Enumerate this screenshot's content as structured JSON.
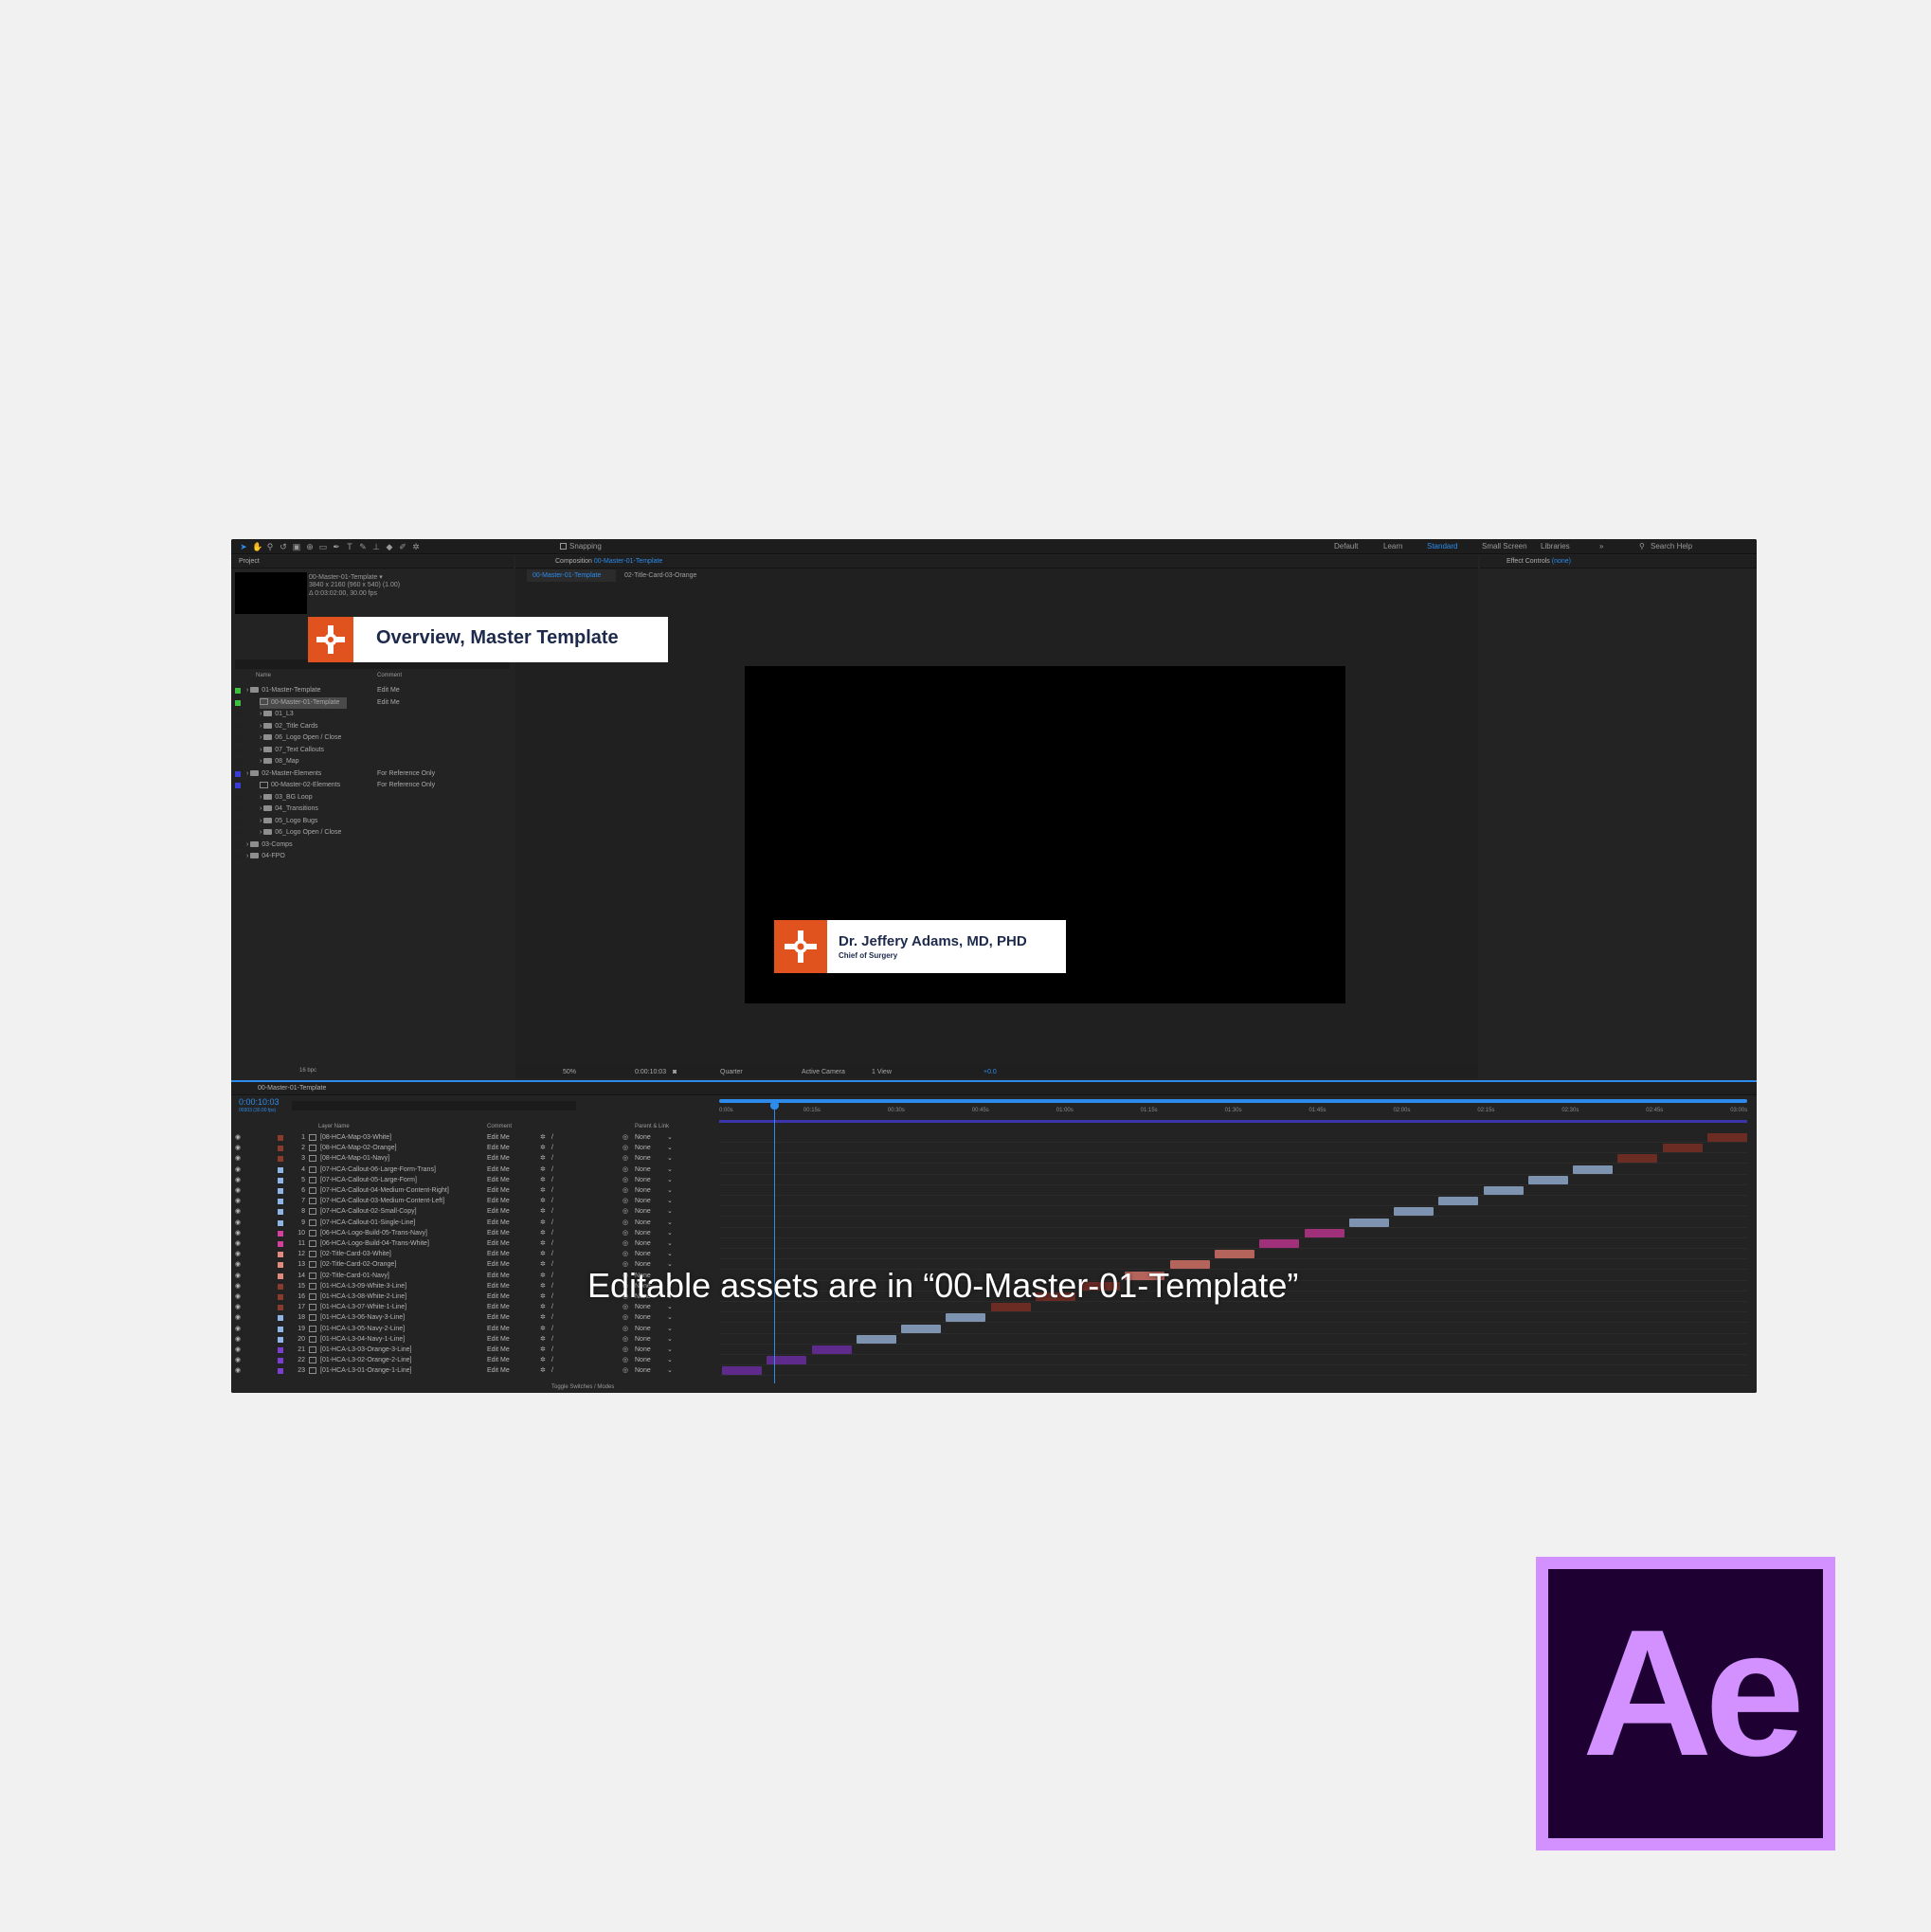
{
  "overlay": {
    "title_badge": "Overview, Master Template",
    "caption": "Editable assets are in “00-Master-01-Template”",
    "ae_logo_text": "Ae"
  },
  "colors": {
    "page_bg": "#f1f1f1",
    "ae_bg": "#232323",
    "brand_orange": "#e0531f",
    "accent_blue": "#2d8ceb",
    "ae_logo_bg": "#1f0033",
    "ae_logo_fg": "#d291ff"
  },
  "toolbar": {
    "snapping": "Snapping",
    "workspaces": [
      "Default",
      "Learn",
      "Standard",
      "Small Screen",
      "Libraries"
    ],
    "active_workspace": "Standard",
    "search_placeholder": "Search Help"
  },
  "project": {
    "panel_title": "Project",
    "selected_name": "00-Master-01-Template ▾",
    "selected_info1": "3840 x 2160  (960 x 540) (1.00)",
    "selected_info2": "Δ 0:03:02:00, 30.00 fps",
    "col_name": "Name",
    "col_comment": "Comment",
    "items": [
      {
        "name": "01-Master-Template",
        "comment": "Edit Me",
        "type": "folder",
        "indent": 0,
        "color": "#3fbf3f"
      },
      {
        "name": "00-Master-01-Template",
        "comment": "Edit Me",
        "type": "comp",
        "indent": 1,
        "color": "#3fbf3f"
      },
      {
        "name": "01_L3",
        "comment": "",
        "type": "folder",
        "indent": 1,
        "color": "#222"
      },
      {
        "name": "02_Title Cards",
        "comment": "",
        "type": "folder",
        "indent": 1,
        "color": "#222"
      },
      {
        "name": "06_Logo Open / Close",
        "comment": "",
        "type": "folder",
        "indent": 1,
        "color": "#222"
      },
      {
        "name": "07_Text Callouts",
        "comment": "",
        "type": "folder",
        "indent": 1,
        "color": "#222"
      },
      {
        "name": "08_Map",
        "comment": "",
        "type": "folder",
        "indent": 1,
        "color": "#222"
      },
      {
        "name": "02-Master-Elements",
        "comment": "For Reference Only",
        "type": "folder",
        "indent": 0,
        "color": "#3b3bd8"
      },
      {
        "name": "00-Master-02-Elements",
        "comment": "For Reference Only",
        "type": "comp",
        "indent": 1,
        "color": "#3b3bd8"
      },
      {
        "name": "03_BG Loop",
        "comment": "",
        "type": "folder",
        "indent": 1,
        "color": "#222"
      },
      {
        "name": "04_Transitions",
        "comment": "",
        "type": "folder",
        "indent": 1,
        "color": "#222"
      },
      {
        "name": "05_Logo Bugs",
        "comment": "",
        "type": "folder",
        "indent": 1,
        "color": "#222"
      },
      {
        "name": "06_Logo Open / Close",
        "comment": "",
        "type": "folder",
        "indent": 1,
        "color": "#222"
      },
      {
        "name": "03-Comps",
        "comment": "",
        "type": "folder",
        "indent": 0,
        "color": "#222"
      },
      {
        "name": "04-FPO",
        "comment": "",
        "type": "folder",
        "indent": 0,
        "color": "#222"
      }
    ],
    "bpc": "16 bpc"
  },
  "composition": {
    "panel_label": "Composition",
    "panel_comp": "00-Master-01-Template",
    "tab_active": "00-Master-01-Template",
    "tab_other": "02-Title-Card-03-Orange",
    "lower_third_name": "Dr. Jeffery Adams, MD, PHD",
    "lower_third_title": "Chief of Surgery",
    "zoom": "50%",
    "timecode": "0:00:10:03",
    "resolution": "Quarter",
    "camera": "Active Camera",
    "view": "1 View",
    "exposure": "+0.0"
  },
  "effects": {
    "panel_label": "Effect Controls",
    "panel_value": "(none)"
  },
  "timeline": {
    "tab": "00-Master-01-Template",
    "timecode": "0:00:10:03",
    "frame_info": "00303 (30.00 fps)",
    "col_layer_name": "Layer Name",
    "col_comment": "Comment",
    "col_parent": "Parent & Link",
    "toggle_label": "Toggle Switches / Modes",
    "ruler": [
      "0:00s",
      "00:15s",
      "00:30s",
      "00:45s",
      "01:00s",
      "01:15s",
      "01:30s",
      "01:45s",
      "02:00s",
      "02:15s",
      "02:30s",
      "02:45s",
      "03:00s"
    ],
    "layers": [
      {
        "num": "1",
        "name": "[08-HCA-Map-03-White]",
        "comment": "Edit Me",
        "parent": "None",
        "color": "#8b3a2e",
        "bar_color": "#6b2c24"
      },
      {
        "num": "2",
        "name": "[08-HCA-Map-02-Orange]",
        "comment": "Edit Me",
        "parent": "None",
        "color": "#8b3a2e",
        "bar_color": "#6b2c24"
      },
      {
        "num": "3",
        "name": "[08-HCA-Map-01-Navy]",
        "comment": "Edit Me",
        "parent": "None",
        "color": "#8b3a2e",
        "bar_color": "#6b2c24"
      },
      {
        "num": "4",
        "name": "[07-HCA-Callout-06-Large-Form-Trans]",
        "comment": "Edit Me",
        "parent": "None",
        "color": "#8fb4e6",
        "bar_color": "#7d93b0"
      },
      {
        "num": "5",
        "name": "[07-HCA-Callout-05-Large-Form]",
        "comment": "Edit Me",
        "parent": "None",
        "color": "#8fb4e6",
        "bar_color": "#7d93b0"
      },
      {
        "num": "6",
        "name": "[07-HCA-Callout-04-Medium-Content-Right]",
        "comment": "Edit Me",
        "parent": "None",
        "color": "#8fb4e6",
        "bar_color": "#7d93b0"
      },
      {
        "num": "7",
        "name": "[07-HCA-Callout-03-Medium-Content-Left]",
        "comment": "Edit Me",
        "parent": "None",
        "color": "#8fb4e6",
        "bar_color": "#7d93b0"
      },
      {
        "num": "8",
        "name": "[07-HCA-Callout-02-Small-Copy]",
        "comment": "Edit Me",
        "parent": "None",
        "color": "#8fb4e6",
        "bar_color": "#7d93b0"
      },
      {
        "num": "9",
        "name": "[07-HCA-Callout-01-Single-Line]",
        "comment": "Edit Me",
        "parent": "None",
        "color": "#8fb4e6",
        "bar_color": "#7d93b0"
      },
      {
        "num": "10",
        "name": "[06-HCA-Logo-Build-05-Trans-Navy]",
        "comment": "Edit Me",
        "parent": "None",
        "color": "#d63fa0",
        "bar_color": "#a0307a"
      },
      {
        "num": "11",
        "name": "[06-HCA-Logo-Build-04-Trans-White]",
        "comment": "Edit Me",
        "parent": "None",
        "color": "#d63fa0",
        "bar_color": "#a0307a"
      },
      {
        "num": "12",
        "name": "[02-Title-Card-03-White]",
        "comment": "Edit Me",
        "parent": "None",
        "color": "#e08a80",
        "bar_color": "#b5645c"
      },
      {
        "num": "13",
        "name": "[02-Title-Card-02-Orange]",
        "comment": "Edit Me",
        "parent": "None",
        "color": "#e08a80",
        "bar_color": "#b5645c"
      },
      {
        "num": "14",
        "name": "[02-Title-Card-01-Navy]",
        "comment": "Edit Me",
        "parent": "None",
        "color": "#e08a80",
        "bar_color": "#b5645c"
      },
      {
        "num": "15",
        "name": "[01-HCA-L3-09-White-3-Line]",
        "comment": "Edit Me",
        "parent": "None",
        "color": "#8b3a2e",
        "bar_color": "#6b2c24"
      },
      {
        "num": "16",
        "name": "[01-HCA-L3-08-White-2-Line]",
        "comment": "Edit Me",
        "parent": "None",
        "color": "#8b3a2e",
        "bar_color": "#6b2c24"
      },
      {
        "num": "17",
        "name": "[01-HCA-L3-07-White-1-Line]",
        "comment": "Edit Me",
        "parent": "None",
        "color": "#8b3a2e",
        "bar_color": "#6b2c24"
      },
      {
        "num": "18",
        "name": "[01-HCA-L3-06-Navy-3-Line]",
        "comment": "Edit Me",
        "parent": "None",
        "color": "#8fb4e6",
        "bar_color": "#7d93b0"
      },
      {
        "num": "19",
        "name": "[01-HCA-L3-05-Navy-2-Line]",
        "comment": "Edit Me",
        "parent": "None",
        "color": "#8fb4e6",
        "bar_color": "#7d93b0"
      },
      {
        "num": "20",
        "name": "[01-HCA-L3-04-Navy-1-Line]",
        "comment": "Edit Me",
        "parent": "None",
        "color": "#8fb4e6",
        "bar_color": "#7d93b0"
      },
      {
        "num": "21",
        "name": "[01-HCA-L3-03-Orange-3-Line]",
        "comment": "Edit Me",
        "parent": "None",
        "color": "#7a3fd0",
        "bar_color": "#5e2a8c"
      },
      {
        "num": "22",
        "name": "[01-HCA-L3-02-Orange-2-Line]",
        "comment": "Edit Me",
        "parent": "None",
        "color": "#7a3fd0",
        "bar_color": "#5e2a8c"
      },
      {
        "num": "23",
        "name": "[01-HCA-L3-01-Orange-1-Line]",
        "comment": "Edit Me",
        "parent": "None",
        "color": "#7a3fd0",
        "bar_color": "#5e2a8c"
      }
    ]
  }
}
